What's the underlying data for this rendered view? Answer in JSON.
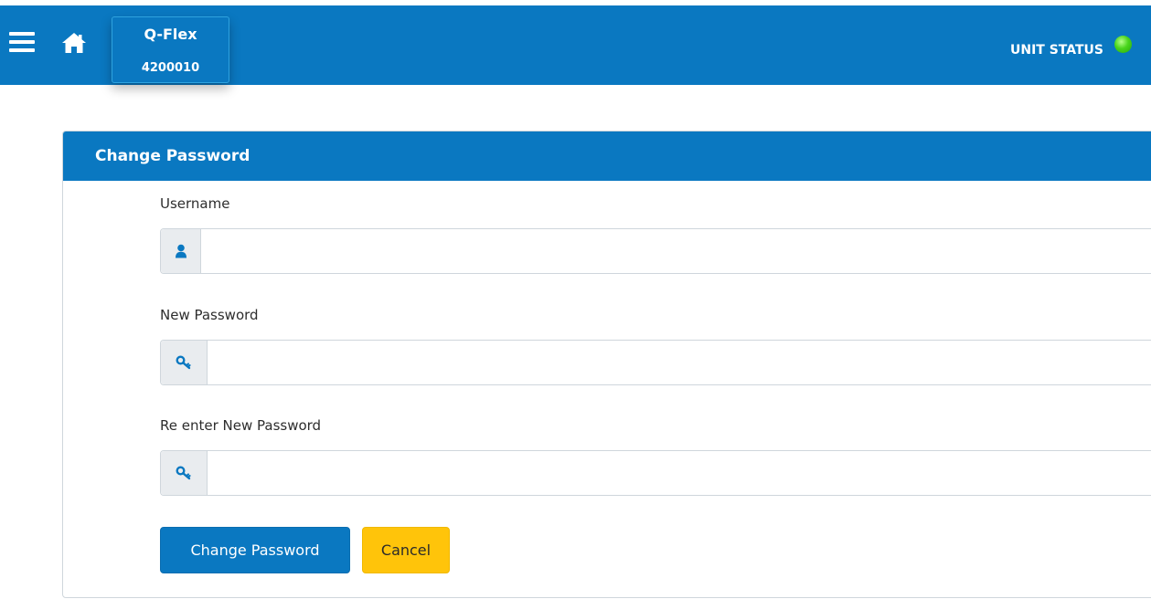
{
  "header": {
    "unit_model": "Q-Flex",
    "unit_serial": "4200010",
    "unit_status_label": "UNIT STATUS",
    "unit_status_color": "#49d51c",
    "menu_icon": "hamburger-menu-icon",
    "home_icon": "home-icon"
  },
  "form": {
    "title": "Change Password",
    "fields": [
      {
        "label": "Username",
        "icon": "user-icon",
        "value": ""
      },
      {
        "label": "New Password",
        "icon": "key-icon",
        "value": ""
      },
      {
        "label": "Re enter New Password",
        "icon": "key-icon",
        "value": ""
      }
    ],
    "submit_label": "Change Password",
    "cancel_label": "Cancel"
  },
  "colors": {
    "brand_blue": "#0a78c1",
    "cancel_yellow": "#ffc40a"
  }
}
